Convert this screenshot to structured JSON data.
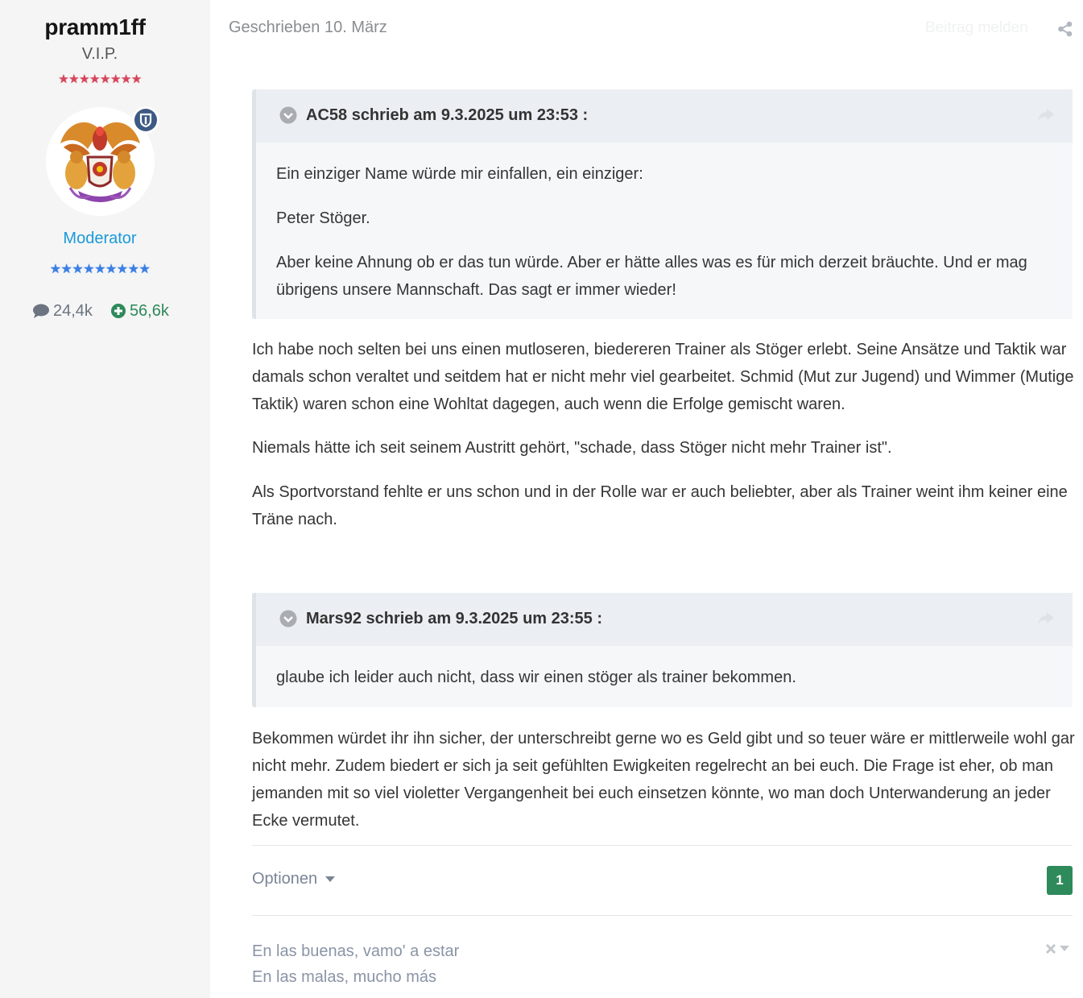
{
  "author": {
    "username": "pramm1ff",
    "rank": "V.I.P.",
    "rank_stars": "★★★★★★★★",
    "group": "Moderator",
    "group_stars": "★★★★★★★★★",
    "posts_count": "24,4k",
    "reputation": "56,6k"
  },
  "post": {
    "meta": "Geschrieben 10. März",
    "report_label": "Beitrag melden",
    "quote1": {
      "citation": "AC58 schrieb am 9.3.2025 um 23:53 :",
      "paragraphs": [
        "Ein einziger Name würde mir einfallen, ein einziger:",
        "Peter Stöger.",
        "Aber keine Ahnung ob er das tun würde. Aber er hätte alles was es für mich derzeit bräuchte. Und er mag übrigens unsere Mannschaft. Das sagt er immer wieder!"
      ]
    },
    "reply1": [
      "Ich habe noch selten bei uns einen mutloseren, biedereren Trainer als Stöger erlebt. Seine Ansätze und Taktik war damals schon veraltet und seitdem hat er nicht mehr viel gearbeitet. Schmid (Mut zur Jugend) und Wimmer (Mutige Taktik) waren schon eine Wohltat dagegen, auch wenn die Erfolge gemischt waren.",
      "Niemals hätte ich seit seinem Austritt gehört, \"schade, dass Stöger nicht mehr Trainer ist\".",
      "Als Sportvorstand fehlte er uns schon und in der Rolle war er auch beliebter, aber als Trainer weint ihm keiner eine Träne nach."
    ],
    "quote2": {
      "citation": "Mars92 schrieb am 9.3.2025 um 23:55 :",
      "paragraphs": [
        "glaube ich leider auch nicht, dass wir einen stöger als trainer bekommen."
      ]
    },
    "reply2": [
      "Bekommen würdet ihr ihn sicher, der unterschreibt gerne wo es Geld gibt und so teuer wäre er mittlerweile wohl gar nicht mehr. Zudem biedert er sich ja seit gefühlten Ewigkeiten regelrecht an bei euch. Die Frage ist eher, ob man jemanden mit so viel violetter Vergangenheit bei euch einsetzen könnte, wo man doch Unterwanderung an jeder Ecke vermutet."
    ],
    "options_label": "Optionen",
    "reaction_count": "1",
    "signature": [
      "En las buenas, vamo' a estar",
      "En las malas, mucho más"
    ]
  },
  "colors": {
    "sidebar_bg": "#f5f5f5",
    "moderator": "#1a9ad9",
    "reputation": "#2e8a5a",
    "rank_stars": "#d6455b",
    "group_stars": "#3a7fe4"
  },
  "icons": [
    "comment-icon",
    "plus-circle-icon",
    "share-icon",
    "chevron-circle-icon",
    "quote-share-icon",
    "caret-down-icon",
    "close-icon",
    "shield-badge-icon"
  ]
}
